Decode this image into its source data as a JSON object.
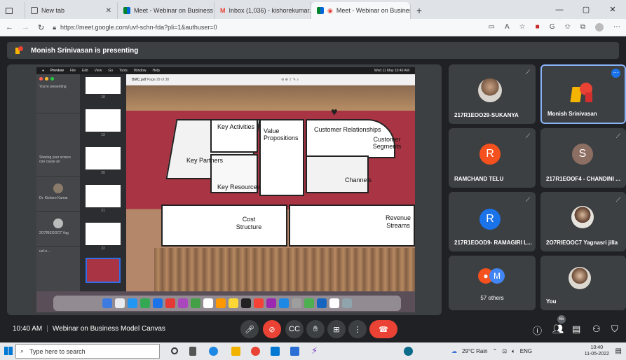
{
  "browser": {
    "tabs": [
      {
        "label": "New tab"
      },
      {
        "label": "Meet - Webinar on Business Mo"
      },
      {
        "label": "Inbox (1,036) - kishorekumar.m"
      },
      {
        "label": "Meet - Webinar on Busines"
      }
    ],
    "url": "https://meet.google.com/uvf-schn-fda?pli=1&authuser=0",
    "new_tab": "+"
  },
  "meet": {
    "presenting_banner": "Monish Srinivasan is presenting",
    "participants": [
      {
        "name": "217R1EOO29-SUKANYA",
        "kind": "photo"
      },
      {
        "name": "Monish Srinivasan",
        "kind": "logo"
      },
      {
        "name": "RAMCHAND TELU",
        "initial": "R",
        "color": "#f4511e"
      },
      {
        "name": "217R1EOOF4 - CHANDINI ...",
        "initial": "S",
        "color": "#8d6e63"
      },
      {
        "name": "217R1EOOD9- RAMAGIRI L...",
        "initial": "R",
        "color": "#1a73e8"
      },
      {
        "name": "2O7RIEOOC7 Yagnasri jilla",
        "kind": "photo"
      },
      {
        "name": "57 others",
        "initial": "M",
        "color": "#4285f4"
      },
      {
        "name": "You",
        "kind": "photo"
      }
    ],
    "meeting_time": "10:40 AM",
    "meeting_title": "Webinar on Business Model Canvas",
    "people_count": "65"
  },
  "slide": {
    "mac_menu": [
      "Preview",
      "File",
      "Edit",
      "View",
      "Go",
      "Tools",
      "Window",
      "Help"
    ],
    "mac_clock": "Wed 11 May  10:40 AM",
    "doc_name": "BMC.pdf",
    "doc_pages": "Page 29 of 38",
    "sidebar_text": "You're presenting",
    "sharing_text": "Sharing your screen can cause an",
    "side_names": [
      "Dr. Kishore Kumar",
      "2O7RIEOOC7 Yag",
      "uvf-e..."
    ],
    "thumb_numbers": [
      "18",
      "19",
      "20",
      "21",
      "22"
    ],
    "bmc_labels": {
      "key_activities": "Key Activities",
      "value_props": "Value Propositions",
      "customer_rel": "Customer Relationships",
      "customer_seg": "Customer Segments",
      "key_partners": "Key Partners",
      "channels": "Channels",
      "key_resources": "Key Resources",
      "cost": "Cost Structure",
      "revenue": "Revenue Streams"
    }
  },
  "taskbar": {
    "search_placeholder": "Type here to search",
    "weather": "29°C  Rain",
    "lang": "ENG",
    "time": "10:40",
    "date": "11-05-2022"
  }
}
